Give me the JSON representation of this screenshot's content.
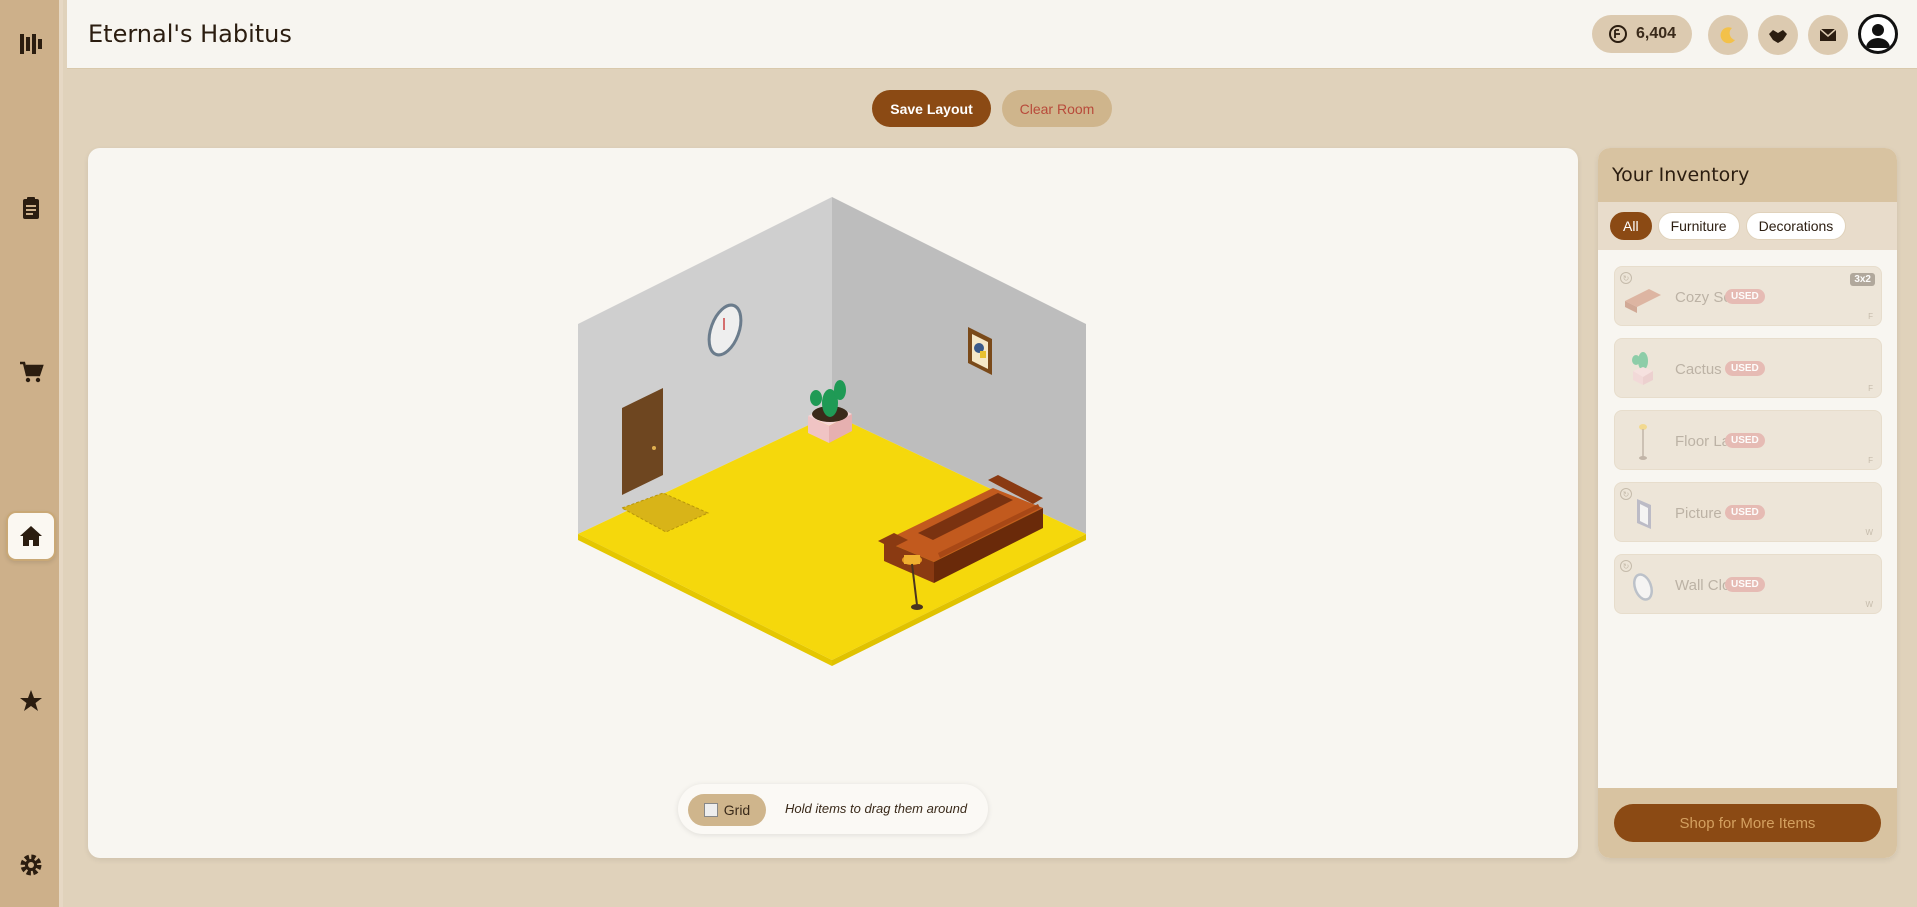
{
  "app": {
    "title": "Eternal's Habitus"
  },
  "header": {
    "coins": "6,404",
    "icons": [
      "coin-icon",
      "moon-icon",
      "guild-icon",
      "mail-icon",
      "user-icon"
    ]
  },
  "sidebar": {
    "items": [
      "logo-icon",
      "clipboard-icon",
      "cart-icon",
      "home-icon",
      "star-icon",
      "gear-icon"
    ],
    "active": "home-icon"
  },
  "toolbar": {
    "save_label": "Save Layout",
    "clear_label": "Clear Room"
  },
  "room": {
    "grid_label": "Grid",
    "hint": "Hold items to drag them around",
    "floor_color": "#f5d80c"
  },
  "inventory": {
    "title": "Your Inventory",
    "tabs": [
      "All",
      "Furniture",
      "Decorations"
    ],
    "active_tab": "All",
    "items": [
      {
        "name": "Cozy Sofa",
        "status": "USED",
        "size": "3x2",
        "kind": "F"
      },
      {
        "name": "Cactus",
        "status": "USED",
        "size": "",
        "kind": "F"
      },
      {
        "name": "Floor Lamp",
        "status": "USED",
        "size": "",
        "kind": "F"
      },
      {
        "name": "Picture",
        "status": "USED",
        "size": "",
        "kind": "W"
      },
      {
        "name": "Wall Clock",
        "status": "USED",
        "size": "",
        "kind": "W"
      }
    ],
    "shop_label": "Shop for More Items"
  },
  "colors": {
    "accent": "#8b4a14",
    "sidebar": "#cdb08a",
    "background": "#e0d2bb"
  }
}
